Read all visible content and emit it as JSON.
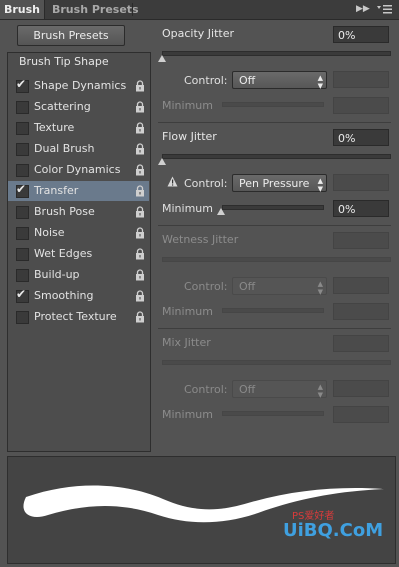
{
  "tabs": {
    "brush": "Brush",
    "presets": "Brush Presets"
  },
  "presets_button": "Brush Presets",
  "tip_shape": "Brush Tip Shape",
  "items": [
    {
      "label": "Shape Dynamics",
      "checked": true,
      "selected": false
    },
    {
      "label": "Scattering",
      "checked": false,
      "selected": false
    },
    {
      "label": "Texture",
      "checked": false,
      "selected": false
    },
    {
      "label": "Dual Brush",
      "checked": false,
      "selected": false
    },
    {
      "label": "Color Dynamics",
      "checked": false,
      "selected": false
    },
    {
      "label": "Transfer",
      "checked": true,
      "selected": true
    },
    {
      "label": "Brush Pose",
      "checked": false,
      "selected": false
    },
    {
      "label": "Noise",
      "checked": false,
      "selected": false
    },
    {
      "label": "Wet Edges",
      "checked": false,
      "selected": false
    },
    {
      "label": "Build-up",
      "checked": false,
      "selected": false
    },
    {
      "label": "Smoothing",
      "checked": true,
      "selected": false
    },
    {
      "label": "Protect Texture",
      "checked": false,
      "selected": false
    }
  ],
  "opacity": {
    "label": "Opacity Jitter",
    "value": "0%",
    "control_label": "Control:",
    "control_value": "Off",
    "min_label": "Minimum"
  },
  "flow": {
    "label": "Flow Jitter",
    "value": "0%",
    "control_label": "Control:",
    "control_value": "Pen Pressure",
    "min_label": "Minimum",
    "min_value": "0%"
  },
  "wetness": {
    "label": "Wetness Jitter",
    "control_label": "Control:",
    "control_value": "Off",
    "min_label": "Minimum"
  },
  "mix": {
    "label": "Mix Jitter",
    "control_label": "Control:",
    "control_value": "Off",
    "min_label": "Minimum"
  },
  "watermark": {
    "main": "UiBQ.CoM",
    "sub": "PS爱好者"
  }
}
